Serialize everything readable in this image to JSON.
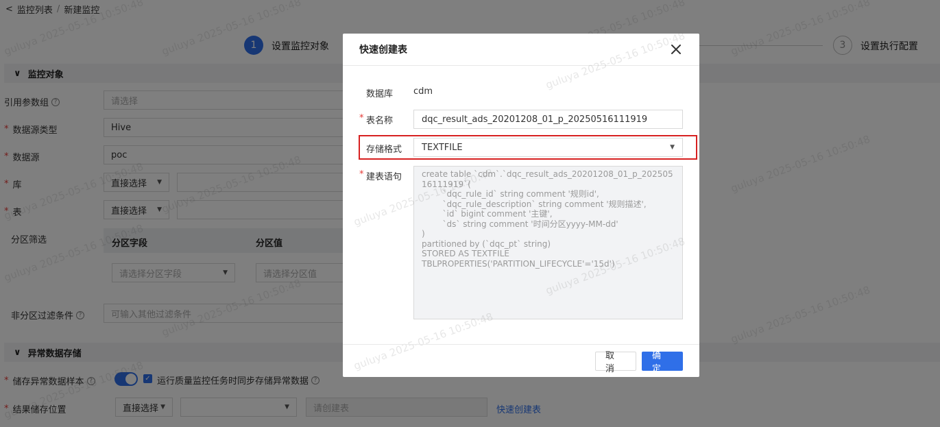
{
  "breadcrumb": {
    "back_icon": "chevron-left-icon",
    "parent": "监控列表",
    "separator": "/",
    "current": "新建监控"
  },
  "steps": {
    "step1_num": "1",
    "step1_label": "设置监控对象",
    "step3_num": "3",
    "step3_label": "设置执行配置"
  },
  "section_monitor": {
    "title": "监控对象"
  },
  "form": {
    "param_group": {
      "label": "引用参数组",
      "placeholder": "请选择"
    },
    "source_type": {
      "label": "数据源类型",
      "value": "Hive"
    },
    "source": {
      "label": "数据源",
      "value": "poc"
    },
    "db": {
      "label": "库",
      "mode": "直接选择"
    },
    "table": {
      "label": "表",
      "mode": "直接选择"
    },
    "partition": {
      "label": "分区筛选",
      "col_field": "分区字段",
      "col_value": "分区值",
      "field_placeholder": "请选择分区字段",
      "value_placeholder": "请选择分区值"
    },
    "filter": {
      "label": "非分区过滤条件",
      "placeholder": "可输入其他过滤条件"
    }
  },
  "section_storage": {
    "title": "异常数据存储"
  },
  "storage": {
    "save_sample_label": "储存异常数据样本",
    "sync_label": "运行质量监控任务时同步存储异常数据",
    "result_label": "结果储存位置",
    "mode": "直接选择",
    "table_placeholder": "请创建表",
    "quick_create_link": "快速创建表"
  },
  "watermark": "guluya 2025-05-16 10:50:48",
  "modal": {
    "title": "快速创建表",
    "db_label": "数据库",
    "db_value": "cdm",
    "table_name_label": "表名称",
    "table_name_value": "dqc_result_ads_20201208_01_p_20250516111919",
    "format_label": "存储格式",
    "format_value": "TEXTFILE",
    "ddl_label": "建表语句",
    "ddl_value": "create table `cdm`.`dqc_result_ads_20201208_01_p_20250516111919`(\n        `dqc_rule_id` string comment '规则id',\n        `dqc_rule_description` string comment '规则描述',\n        `id` bigint comment '主键',\n        `ds` string comment '时间分区yyyy-MM-dd'\n)\npartitioned by (`dqc_pt` string)\nSTORED AS TEXTFILE\nTBLPROPERTIES('PARTITION_LIFECYCLE'='15d')",
    "cancel_label": "取 消",
    "ok_label": "确 定"
  }
}
